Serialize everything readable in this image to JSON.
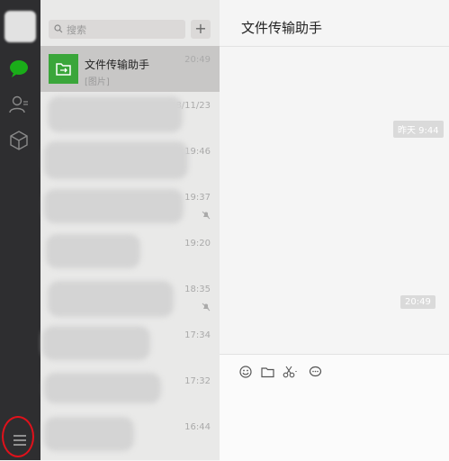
{
  "sidebar": {
    "icons": [
      "avatar",
      "chat-icon",
      "contacts-icon",
      "favorites-icon",
      "menu-icon"
    ],
    "accent": "#1aad19"
  },
  "search": {
    "placeholder": "搜索",
    "add_label": "+"
  },
  "chats": [
    {
      "name": "文件传输助手",
      "preview": "[图片]",
      "time": "20:49",
      "active": true
    },
    {
      "name": "",
      "preview": "",
      "time": "18/11/23",
      "muted": false
    },
    {
      "name": "",
      "preview": "",
      "time": "19:46",
      "muted": false
    },
    {
      "name": "",
      "preview": "",
      "time": "19:37",
      "muted": true
    },
    {
      "name": "",
      "preview": "",
      "time": "19:20",
      "muted": false
    },
    {
      "name": "",
      "preview": "",
      "time": "18:35",
      "muted": true
    },
    {
      "name": "",
      "preview": "",
      "time": "17:34",
      "muted": false
    },
    {
      "name": "",
      "preview": "",
      "time": "17:32",
      "muted": false
    },
    {
      "name": "",
      "preview": "",
      "time": "16:44",
      "muted": false
    }
  ],
  "conversation": {
    "title": "文件传输助手",
    "timestamps": [
      "昨天 9:44",
      "20:49"
    ]
  },
  "toolbar": [
    "emoji-icon",
    "folder-icon",
    "scissors-icon",
    "bubble-icon"
  ]
}
